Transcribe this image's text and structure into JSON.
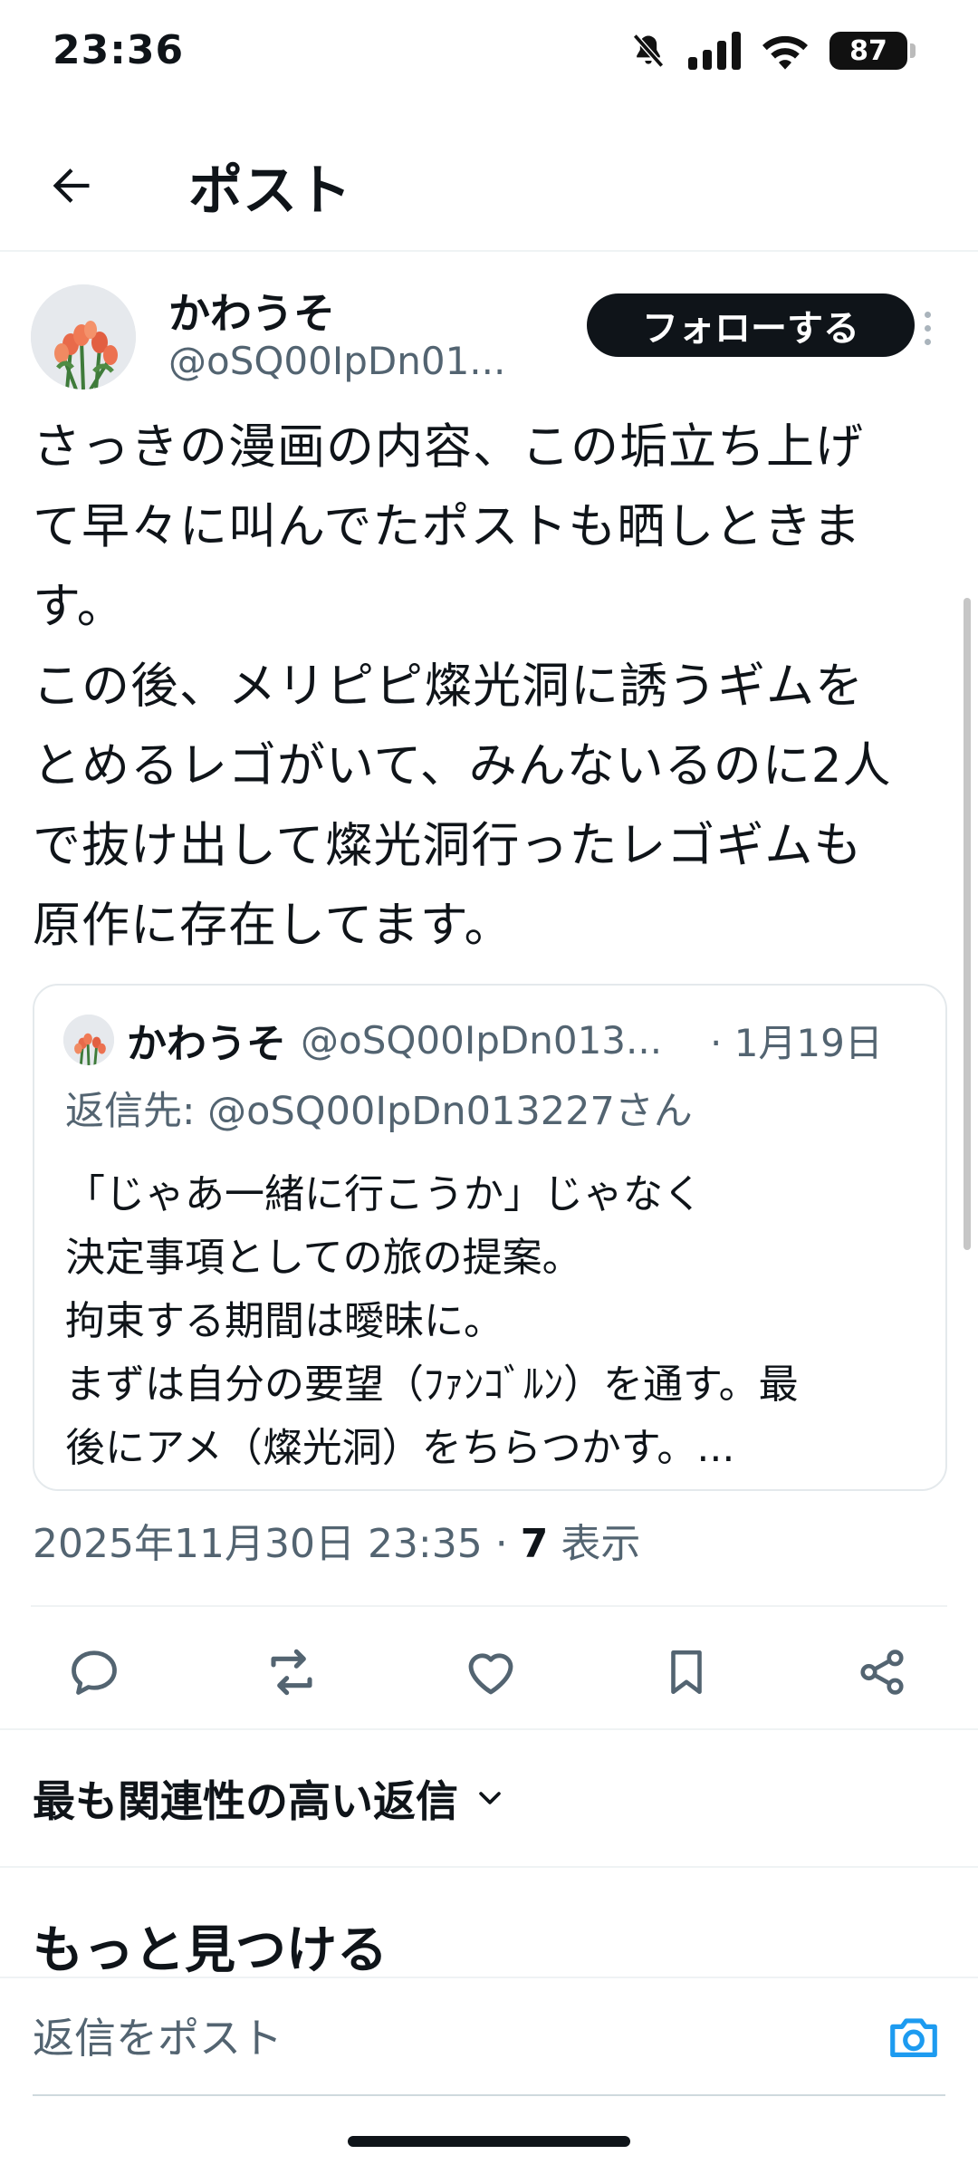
{
  "status_bar": {
    "time": "23:36",
    "battery": "87",
    "icons": [
      "mute-icon",
      "signal-icon",
      "wifi-icon",
      "battery-icon"
    ]
  },
  "header": {
    "title": "ポスト",
    "back_icon": "arrow-left-icon"
  },
  "post": {
    "author_name": "かわうそ",
    "author_handle": "@oSQ00IpDn01...",
    "follow_label": "フォローする",
    "text": "さっきの漫画の内容、この垢立ち上げ\nて早々に叫んでたポストも晒しときま\nす。\nこの後、メリピピ燦光洞に誘うギムを\nとめるレゴがいて、みんないるのに2人\nで抜け出して燦光洞行ったレゴギムも\n原作に存在してます。",
    "timestamp": "2025年11月30日 23:35",
    "separator": "·",
    "views_count": "7",
    "views_label": "表示"
  },
  "quote": {
    "author_name": "かわうそ",
    "author_handle": "@oSQ00IpDn013...",
    "date": "· 1月19日",
    "reply_to": "返信先: @oSQ00IpDn013227さん",
    "text": "「じゃあ一緒に行こうか」じゃなく\n決定事項としての旅の提案。\n拘束する期間は曖昧に。\nまずは自分の要望（ﾌｧﾝｺﾞﾙﾝ）を通す。最\n後にアメ（燦光洞）をちらつかす。..."
  },
  "actions": [
    {
      "name": "reply-icon"
    },
    {
      "name": "repost-icon"
    },
    {
      "name": "like-icon"
    },
    {
      "name": "bookmark-icon"
    },
    {
      "name": "share-icon"
    }
  ],
  "replies": {
    "sort_label": "最も関連性の高い返信"
  },
  "discover": {
    "title": "もっと見つける"
  },
  "reply_bar": {
    "placeholder": "返信をポスト"
  },
  "colors": {
    "text": "#0f1419",
    "secondary": "#536471",
    "accent": "#1d9bf0",
    "border": "#eff3f4"
  }
}
